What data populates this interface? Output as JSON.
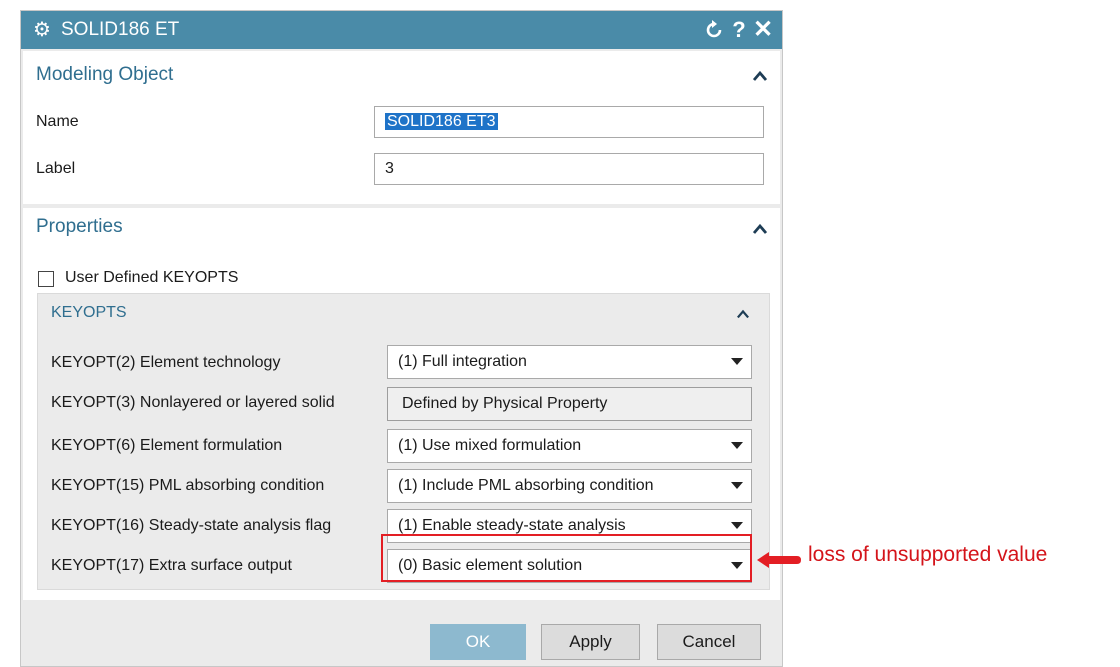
{
  "dialog": {
    "title": "SOLID186 ET",
    "title_icon": "gear-icon",
    "reset_icon": "reset-icon",
    "help_symbol": "?",
    "close_symbol": "✕"
  },
  "modeling_object": {
    "heading": "Modeling Object",
    "name_label": "Name",
    "name_value": "SOLID186 ET3",
    "label_label": "Label",
    "label_value": "3"
  },
  "properties": {
    "heading": "Properties",
    "user_defined_label": "User Defined KEYOPTS",
    "user_defined_checked": false,
    "keyopts": {
      "heading": "KEYOPTS",
      "rows": [
        {
          "label": "KEYOPT(2) Element technology",
          "value": "(1) Full integration",
          "type": "dropdown"
        },
        {
          "label": "KEYOPT(3) Nonlayered or layered solid",
          "value": "Defined by Physical Property",
          "type": "readonly"
        },
        {
          "label": "KEYOPT(6) Element formulation",
          "value": "(1) Use mixed formulation",
          "type": "dropdown"
        },
        {
          "label": "KEYOPT(15) PML absorbing condition",
          "value": "(1) Include PML absorbing condition",
          "type": "dropdown"
        },
        {
          "label": "KEYOPT(16) Steady-state analysis flag",
          "value": "(1) Enable steady-state analysis",
          "type": "dropdown"
        },
        {
          "label": "KEYOPT(17) Extra surface output",
          "value": "(0) Basic element solution",
          "type": "dropdown"
        }
      ]
    }
  },
  "buttons": {
    "ok": "OK",
    "apply": "Apply",
    "cancel": "Cancel"
  },
  "annotation": {
    "text": "loss of unsupported value",
    "color": "#d4141a"
  },
  "colors": {
    "titlebar": "#4a8ba8",
    "section_heading": "#2f6e8f",
    "selection": "#1e73c8"
  }
}
